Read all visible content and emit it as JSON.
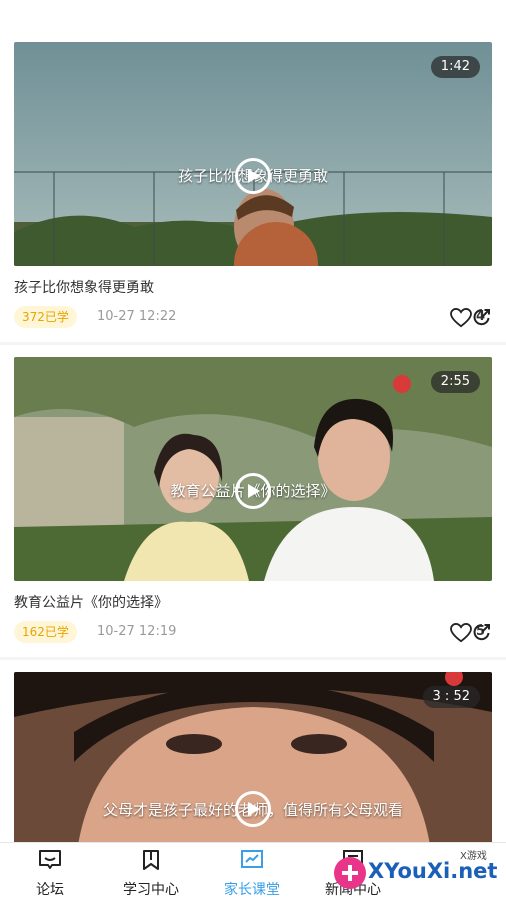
{
  "feed": {
    "videos": [
      {
        "duration": "1:42",
        "overlay_title": "孩子比你想象得更勇敢",
        "caption": "孩子比你想象得更勇敢",
        "learned": "372已学",
        "date": "10-27 12:22",
        "likes": "4"
      },
      {
        "duration": "2:55",
        "overlay_title": "教育公益片《你的选择》",
        "caption": "教育公益片《你的选择》",
        "learned": "162已学",
        "date": "10-27 12:19",
        "likes": "5"
      },
      {
        "duration": "3 : 52",
        "overlay_title": "父母才是孩子最好的老师，值得所有父母观看"
      }
    ]
  },
  "tabbar": {
    "tabs": [
      {
        "label": "论坛",
        "icon": "chat-bubble-icon"
      },
      {
        "label": "学习中心",
        "icon": "bookmark-icon"
      },
      {
        "label": "家长课堂",
        "icon": "chart-board-icon",
        "active": true
      },
      {
        "label": "新闻中心",
        "icon": "news-icon"
      }
    ]
  },
  "watermark": {
    "text": "XYouXi.net",
    "small": "X游戏"
  },
  "colors": {
    "accent": "#3a9fe8",
    "learned_badge": "#e8a400"
  }
}
